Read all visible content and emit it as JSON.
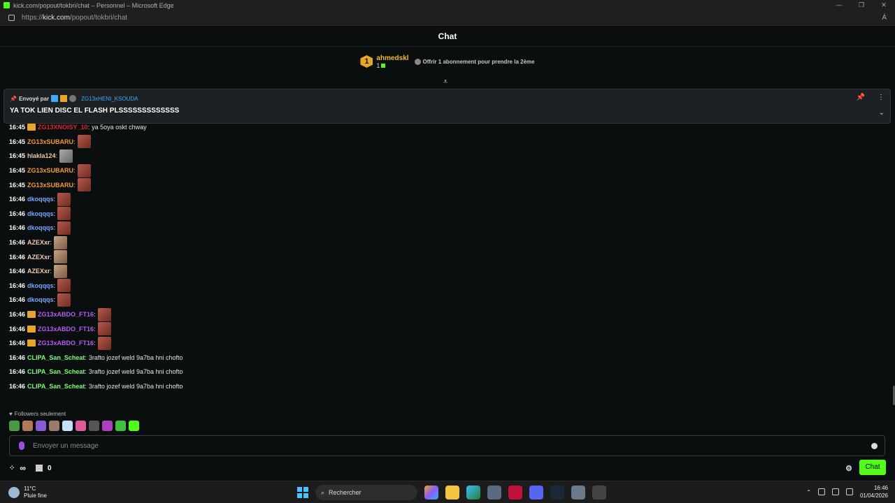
{
  "browser": {
    "title": "kick.com/popout/tokbri/chat – Personnel – Microsoft Edge",
    "url_prefix": "https://",
    "url_host": "kick.com",
    "url_path": "/popout/tokbri/chat",
    "read_aloud": "Á"
  },
  "chat": {
    "title": "Chat",
    "gifter": {
      "rank": "1",
      "name": "ahmedskl",
      "count": "1",
      "offer_text": "Offrir 1 abonnement pour prendre la 2ème"
    },
    "pinned": {
      "sent_by_label": "Envoyé par",
      "sender": "ZG13xHENI_KSOUDA",
      "message": "YA TOK LIEN DISC EL FLASH PLSSSSSSSSSSSSS"
    },
    "messages": [
      {
        "time": "16:45",
        "user": "ZG13XNOISY_10",
        "color": "#e0242e",
        "crown": true,
        "text": "ya 5oya oskt chway",
        "emote": ""
      },
      {
        "time": "16:45",
        "user": "ZG13xSUBARU",
        "color": "#f29a36",
        "crown": false,
        "text": "",
        "emote": "skull"
      },
      {
        "time": "16:45",
        "user": "hlakla124",
        "color": "#f3c7a3",
        "crown": false,
        "text": "",
        "emote": "gray"
      },
      {
        "time": "16:45",
        "user": "ZG13xSUBARU",
        "color": "#f29a36",
        "crown": false,
        "text": "",
        "emote": "skull"
      },
      {
        "time": "16:45",
        "user": "ZG13xSUBARU",
        "color": "#f29a36",
        "crown": false,
        "text": "",
        "emote": "skull"
      },
      {
        "time": "16:46",
        "user": "dkoqqqs",
        "color": "#7aa7ff",
        "crown": false,
        "text": "",
        "emote": "skull"
      },
      {
        "time": "16:46",
        "user": "dkoqqqs",
        "color": "#7aa7ff",
        "crown": false,
        "text": "",
        "emote": "skull"
      },
      {
        "time": "16:46",
        "user": "dkoqqqs",
        "color": "#7aa7ff",
        "crown": false,
        "text": "",
        "emote": "skull"
      },
      {
        "time": "16:46",
        "user": "AZEXxr",
        "color": "#f6c9b0",
        "crown": false,
        "text": "",
        "emote": "cat"
      },
      {
        "time": "16:46",
        "user": "AZEXxr",
        "color": "#f6c9b0",
        "crown": false,
        "text": "",
        "emote": "cat"
      },
      {
        "time": "16:46",
        "user": "AZEXxr",
        "color": "#f6c9b0",
        "crown": false,
        "text": "",
        "emote": "cat"
      },
      {
        "time": "16:46",
        "user": "dkoqqqs",
        "color": "#7aa7ff",
        "crown": false,
        "text": "",
        "emote": "skull"
      },
      {
        "time": "16:46",
        "user": "dkoqqqs",
        "color": "#7aa7ff",
        "crown": false,
        "text": "",
        "emote": "skull"
      },
      {
        "time": "16:46",
        "user": "ZG13xABDO_FT16",
        "color": "#b25cf5",
        "crown": true,
        "text": "",
        "emote": "skull"
      },
      {
        "time": "16:46",
        "user": "ZG13xABDO_FT16",
        "color": "#b25cf5",
        "crown": true,
        "text": "",
        "emote": "skull"
      },
      {
        "time": "16:46",
        "user": "ZG13xABDO_FT16",
        "color": "#b25cf5",
        "crown": true,
        "text": "",
        "emote": "skull"
      },
      {
        "time": "16:46",
        "user": "CLIPA_San_Scheat",
        "color": "#7dff7a",
        "crown": false,
        "text": "3rafto jozef weld 9a7ba hni chofto",
        "emote": ""
      },
      {
        "time": "16:46",
        "user": "CLIPA_San_Scheat",
        "color": "#7dff7a",
        "crown": false,
        "text": "3rafto jozef weld 9a7ba hni chofto",
        "emote": ""
      },
      {
        "time": "16:46",
        "user": "CLIPA_San_Scheat",
        "color": "#7dff7a",
        "crown": false,
        "text": "3rafto jozef weld 9a7ba hni chofto",
        "emote": ""
      }
    ],
    "followers_only": "Followers seulement",
    "input_placeholder": "Envoyer un message",
    "loop_symbol": "∞",
    "gift_count": "0",
    "send_label": "Chat"
  },
  "taskbar": {
    "temperature": "11°C",
    "weather": "Pluie fine",
    "search_label": "Rechercher",
    "time": "16:46",
    "date": "01/04/2026"
  }
}
